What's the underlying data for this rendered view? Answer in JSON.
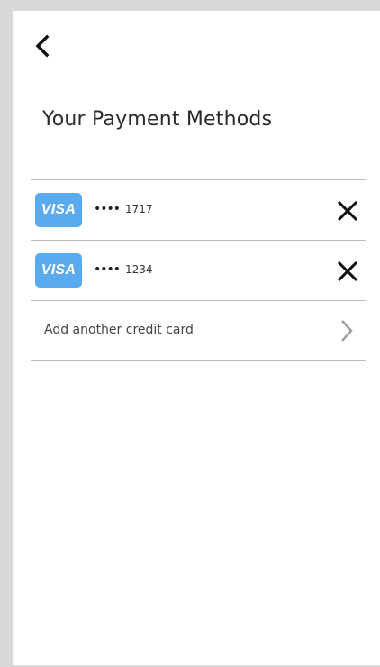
{
  "header": {
    "back_icon": "chevron-left-icon",
    "title": "Your Payment Methods"
  },
  "cards": [
    {
      "brand": "VISA",
      "masked_prefix": "••••",
      "last4": "1717",
      "remove_icon": "close-icon"
    },
    {
      "brand": "VISA",
      "masked_prefix": "••••",
      "last4": "1234",
      "remove_icon": "close-icon"
    }
  ],
  "add_card": {
    "label": "Add another credit card",
    "icon": "chevron-right-icon"
  },
  "colors": {
    "visa_badge": "#5aaaf0",
    "divider": "#bdbdbd",
    "text": "#2b2b2b"
  }
}
